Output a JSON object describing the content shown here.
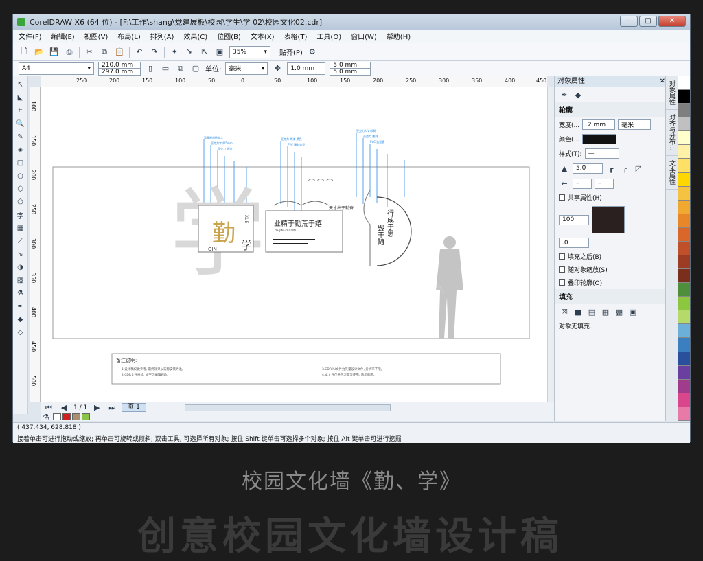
{
  "window": {
    "title": "CorelDRAW X6 (64 位) - [F:\\工作\\shang\\党建展板\\校园\\学生\\学 02\\校园文化02.cdr]"
  },
  "menu": [
    "文件(F)",
    "编辑(E)",
    "视图(V)",
    "布局(L)",
    "排列(A)",
    "效果(C)",
    "位图(B)",
    "文本(X)",
    "表格(T)",
    "工具(O)",
    "窗口(W)",
    "帮助(H)"
  ],
  "toolbar1": {
    "zoom": "35%",
    "snap": "贴齐(P)"
  },
  "toolbar2": {
    "page_size": "A4",
    "width": "210.0 mm",
    "height": "297.0 mm",
    "units_label": "单位:",
    "units": "毫米",
    "nudge": "1.0 mm",
    "dup_x": "5.0 mm",
    "dup_y": "5.0 mm"
  },
  "ruler_h": [
    "250",
    "200",
    "150",
    "100",
    "50",
    "0",
    "50",
    "100",
    "150",
    "200",
    "250",
    "300",
    "350",
    "400",
    "450"
  ],
  "ruler_v": [
    "100",
    "150",
    "200",
    "250",
    "300",
    "350",
    "400",
    "450",
    "500"
  ],
  "artwork": {
    "big_char": "学",
    "qin": "勤",
    "xue": "学",
    "qin_pinyin": "QIN",
    "xue_pinyin": "XUE",
    "slogan": "业精于勤荒于嬉",
    "slogan_pinyin": "YE JING YU QIN",
    "small_slogan": "天才出于勤奋",
    "vertical1": "行成于思",
    "vertical2": "毁于随",
    "notes_title": "备注说明:",
    "notes_left1": "1.设计稿仅做参考, 最终效果以实际安装为准。",
    "notes_left2": "2.CDR文件格式, 文字可编辑修改。",
    "notes_right1": "3.CDR/AI文件为矢量设计文件, 分辨率不限。",
    "notes_right2": "4.本文件仅供学习交流使用, 请勿商用。"
  },
  "page_nav": {
    "counter": "1 / 1",
    "tab": "页 1"
  },
  "status": {
    "coords": "( 437.434, 628.818 )",
    "hint": "接着单击可进行拖动或缩放; 再单击可旋转或倾斜; 双击工具, 可选择所有对象; 按住 Shift 键单击可选择多个对象; 按住 Alt 键单击可进行挖掘"
  },
  "docker": {
    "title": "对象属性",
    "outline": "轮廓",
    "width_label": "宽度(...",
    "width_val": ".2 mm",
    "width_unit": "毫米",
    "color_label": "颜色(...",
    "style_label": "样式(T):",
    "miter": "5.0",
    "share": "共享属性(H)",
    "stretch": "100",
    "angle": ".0",
    "fill_after": "填充之后(B)",
    "scale_with": "随对象缩放(S)",
    "overprint": "叠印轮廓(O)",
    "fill": "填充",
    "no_fill": "对象无填充."
  },
  "sidetabs": [
    "对象属性",
    "对齐与分布...",
    "文本属性"
  ],
  "palette": [
    "#ffffff",
    "#000000",
    "#7f7f7f",
    "#c0c0c0",
    "#ffffcc",
    "#fff2a8",
    "#ffe066",
    "#ffd700",
    "#f5c242",
    "#f0a830",
    "#e8862a",
    "#d9662a",
    "#c0502a",
    "#9c3c24",
    "#7a2e1c",
    "#4f8f3c",
    "#8dc63f",
    "#b5d96b",
    "#6cb0d9",
    "#3c7fc0",
    "#2a4f9c",
    "#6b3fa0",
    "#a03c8c",
    "#d9468c",
    "#e87aa8"
  ],
  "caption": "校园文化墙《勤、学》",
  "bigtext": "创意校园文化墙设计稿"
}
